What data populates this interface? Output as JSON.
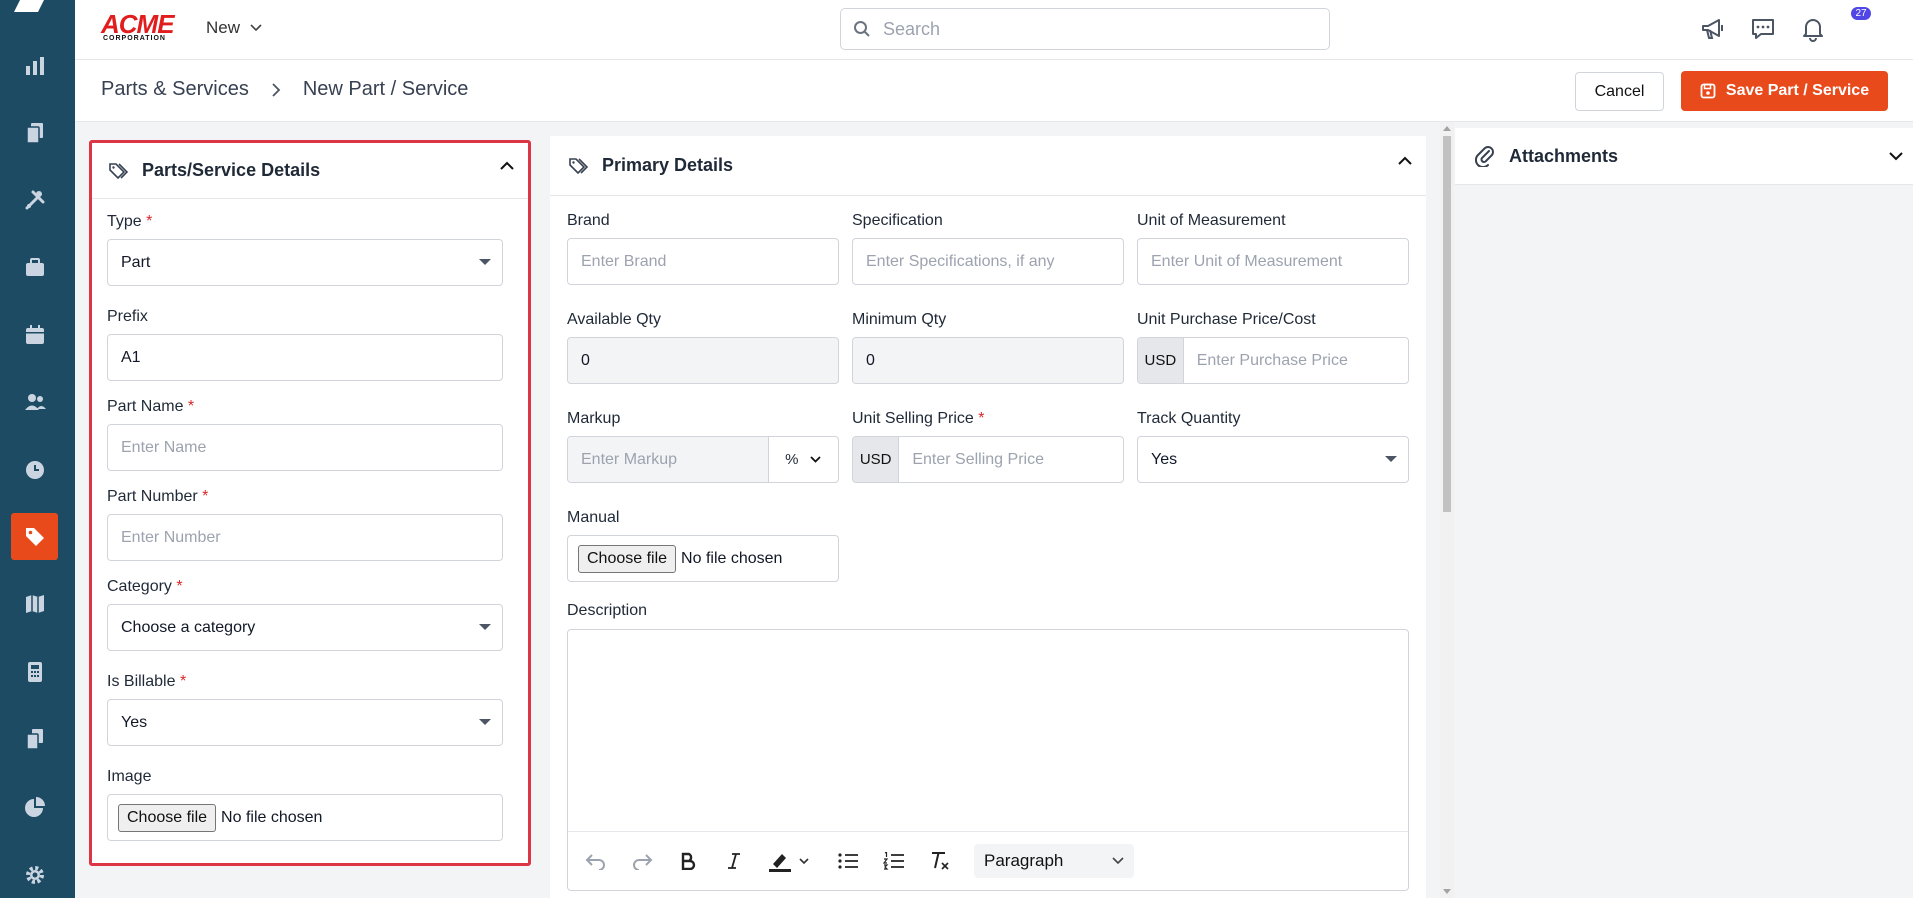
{
  "brand": {
    "name": "ACME",
    "sub": "CORPORATION"
  },
  "topbar": {
    "new_label": "New",
    "search_placeholder": "Search",
    "notification_count": "27"
  },
  "breadcrumb": {
    "parent": "Parts & Services",
    "current": "New Part / Service"
  },
  "actions": {
    "cancel": "Cancel",
    "save": "Save Part / Service"
  },
  "left_panel": {
    "title": "Parts/Service Details",
    "type_label": "Type",
    "type_value": "Part",
    "prefix_label": "Prefix",
    "prefix_value": "A1",
    "part_name_label": "Part Name",
    "part_name_placeholder": "Enter Name",
    "part_number_label": "Part Number",
    "part_number_placeholder": "Enter Number",
    "category_label": "Category",
    "category_value": "Choose a category",
    "billable_label": "Is Billable",
    "billable_value": "Yes",
    "image_label": "Image",
    "file_button": "Choose file",
    "file_status": "No file chosen"
  },
  "primary": {
    "title": "Primary Details",
    "brand_label": "Brand",
    "brand_placeholder": "Enter Brand",
    "spec_label": "Specification",
    "spec_placeholder": "Enter Specifications, if any",
    "uom_label": "Unit of Measurement",
    "uom_placeholder": "Enter Unit of Measurement",
    "avail_label": "Available Qty",
    "avail_value": "0",
    "min_label": "Minimum Qty",
    "min_value": "0",
    "cost_label": "Unit Purchase Price/Cost",
    "cost_currency": "USD",
    "cost_placeholder": "Enter Purchase Price",
    "markup_label": "Markup",
    "markup_placeholder": "Enter Markup",
    "markup_unit": "%",
    "sell_label": "Unit Selling Price",
    "sell_currency": "USD",
    "sell_placeholder": "Enter Selling Price",
    "track_label": "Track Quantity",
    "track_value": "Yes",
    "manual_label": "Manual",
    "file_button": "Choose file",
    "file_status": "No file chosen",
    "desc_label": "Description",
    "paragraph": "Paragraph"
  },
  "attachments": {
    "title": "Attachments"
  },
  "colors": {
    "sidebar": "#1d4b63",
    "accent": "#e84a1b",
    "highlight_border": "#dc3545"
  }
}
